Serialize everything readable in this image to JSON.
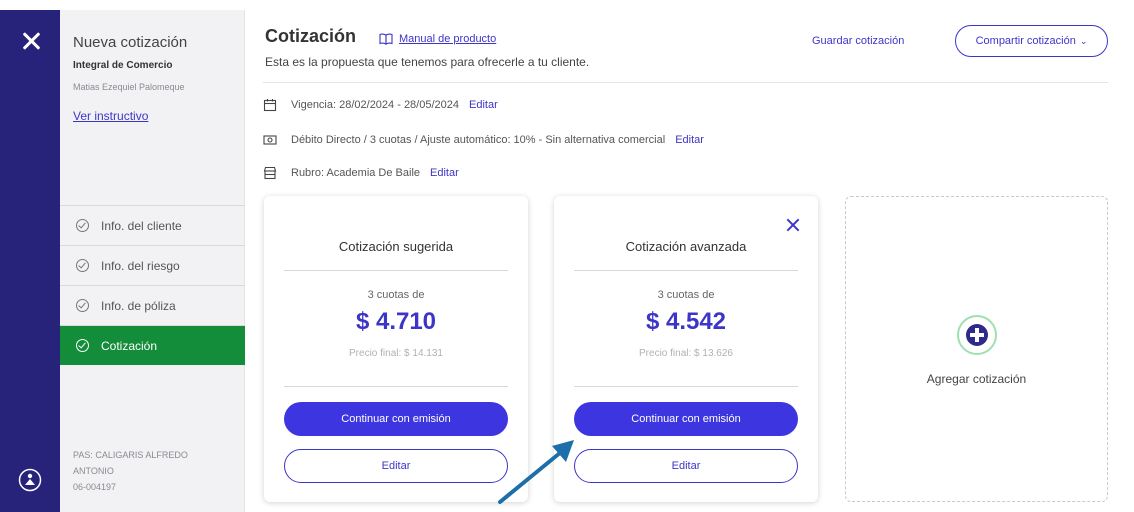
{
  "sidebar": {
    "title": "Nueva cotización",
    "company": "Integral de Comercio",
    "person": "Matias Ezequiel Palomeque",
    "instructions_link": "Ver instructivo",
    "nav": [
      {
        "label": "Info. del cliente",
        "active": false
      },
      {
        "label": "Info. del riesgo",
        "active": false
      },
      {
        "label": "Info. de póliza",
        "active": false
      },
      {
        "label": "Cotización",
        "active": true
      }
    ],
    "footer": [
      "PAS: CALIGARIS ALFREDO",
      "ANTONIO",
      "06-004197"
    ]
  },
  "header": {
    "title": "Cotización",
    "manual_link": "Manual de producto",
    "subtitle": "Esta es la propuesta que tenemos para ofrecerle a tu cliente.",
    "save_label": "Guardar cotización",
    "share_label": "Compartir cotización",
    "share_chevron": "⌄"
  },
  "meta": {
    "vigencia": "Vigencia: 28/02/2024 - 28/05/2024",
    "pago": "Débito Directo / 3 cuotas / Ajuste automático: 10% - Sin alternativa comercial",
    "rubro": "Rubro: Academia De Baile",
    "edit_label": "Editar"
  },
  "cards": [
    {
      "title": "Cotización sugerida",
      "cuotas": "3 cuotas de",
      "price": "$ 4.710",
      "final": "Precio final: $ 14.131",
      "primary": "Continuar con emisión",
      "secondary": "Editar"
    },
    {
      "title": "Cotización avanzada",
      "cuotas": "3 cuotas de",
      "price": "$ 4.542",
      "final": "Precio final: $ 13.626",
      "primary": "Continuar con emisión",
      "secondary": "Editar"
    }
  ],
  "add_card": {
    "label": "Agregar cotización"
  },
  "colors": {
    "rail": "#28237a",
    "accent": "#3d35c8",
    "active_nav": "#138d3a"
  }
}
